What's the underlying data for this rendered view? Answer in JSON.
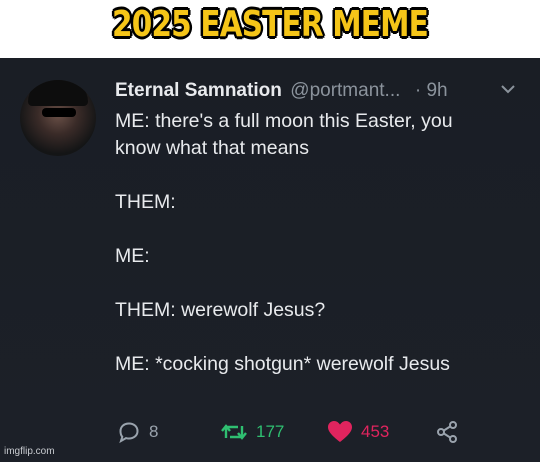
{
  "banner": {
    "title": "2025 EASTER MEME"
  },
  "tweet": {
    "author": "Eternal Samnation",
    "handle": "@portmant...",
    "time": "· 9h",
    "lines": [
      "ME: there's a full moon this Easter, you",
      "know what that means",
      "",
      "THEM:",
      "",
      "ME:",
      "",
      "THEM: werewolf Jesus?",
      "",
      "ME: *cocking shotgun* werewolf Jesus"
    ],
    "replies": "8",
    "retweets": "177",
    "likes": "453"
  },
  "colors": {
    "retweet": "#2fbf71",
    "like": "#e0245e",
    "banner_text": "#f5c518"
  },
  "icons": [
    "reply-icon",
    "retweet-icon",
    "heart-icon",
    "share-icon",
    "chevron-down-icon"
  ],
  "watermark": "imgflip.com"
}
